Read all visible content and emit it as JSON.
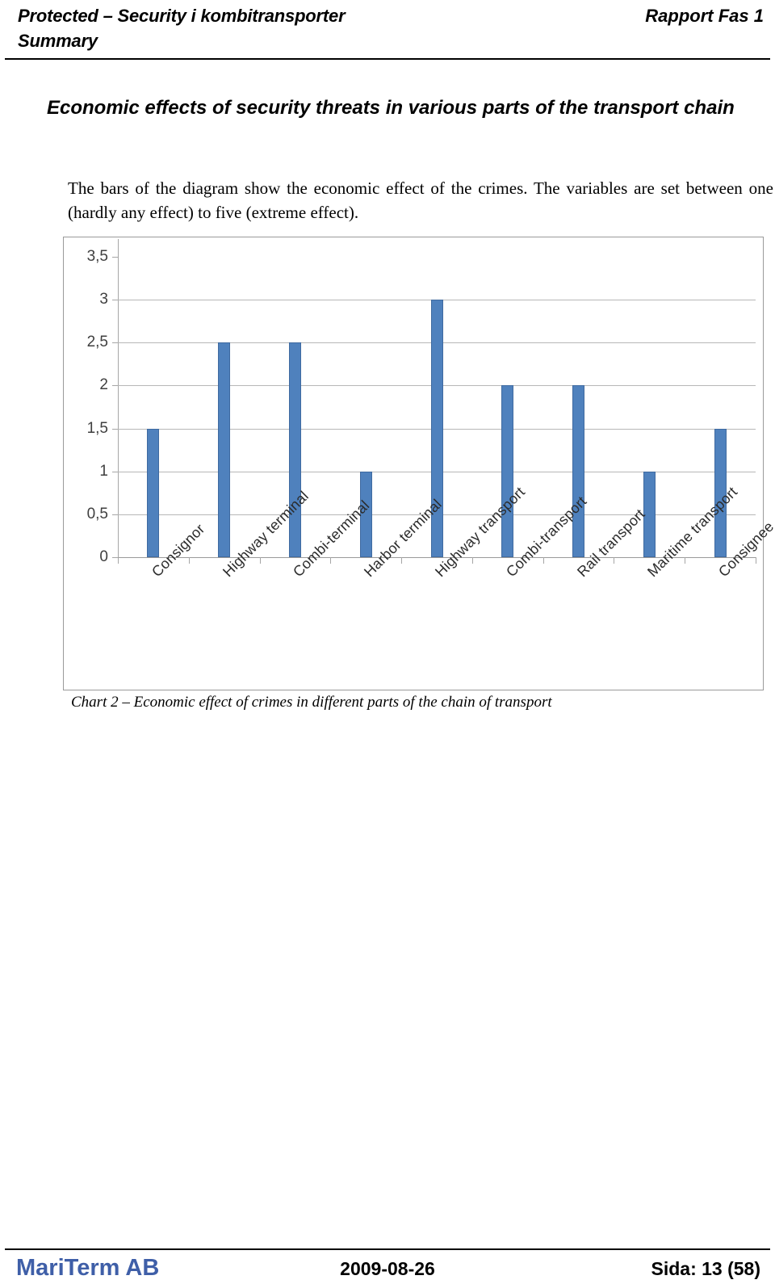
{
  "header": {
    "left_title": "Protected – Security i kombitransporter\nSummary",
    "right_title": "Rapport Fas 1"
  },
  "section": {
    "title": "Economic effects of security threats in various parts of the transport chain",
    "paragraph": "The bars of the diagram show the economic effect of the crimes. The variables are set between one (hardly any effect) to five (extreme effect)."
  },
  "caption": "Chart 2 – Economic effect of crimes in different parts of the chain of transport",
  "footer": {
    "company": "MariTerm AB",
    "date": "2009-08-26",
    "page": "Sida: 13 (58)"
  },
  "colors": {
    "bar": "#4f81bd",
    "bar_border": "#3f6aa0",
    "gridline": "#b7b7b7",
    "axis": "#a6a6a6",
    "company_blue": "#3f5fa8"
  },
  "chart_data": {
    "type": "bar",
    "title": "",
    "xlabel": "",
    "ylabel": "",
    "ylim": [
      0,
      3.5
    ],
    "ytick_labels": [
      "0",
      "0,5",
      "1",
      "1,5",
      "2",
      "2,5",
      "3",
      "3,5"
    ],
    "ytick_values": [
      0,
      0.5,
      1,
      1.5,
      2,
      2.5,
      3,
      3.5
    ],
    "grid": true,
    "legend": false,
    "categories": [
      "Consignor",
      "Highway terminal",
      "Combi-terminal",
      "Harbor terminal",
      "Highway transport",
      "Combi-transport",
      "Rail transport",
      "Maritime transport",
      "Consignee"
    ],
    "values": [
      1.5,
      2.5,
      2.5,
      1,
      3,
      2,
      2,
      1,
      1.5
    ],
    "series": [
      {
        "name": "Economic effect",
        "values": [
          1.5,
          2.5,
          2.5,
          1,
          3,
          2,
          2,
          1,
          1.5
        ]
      }
    ]
  }
}
